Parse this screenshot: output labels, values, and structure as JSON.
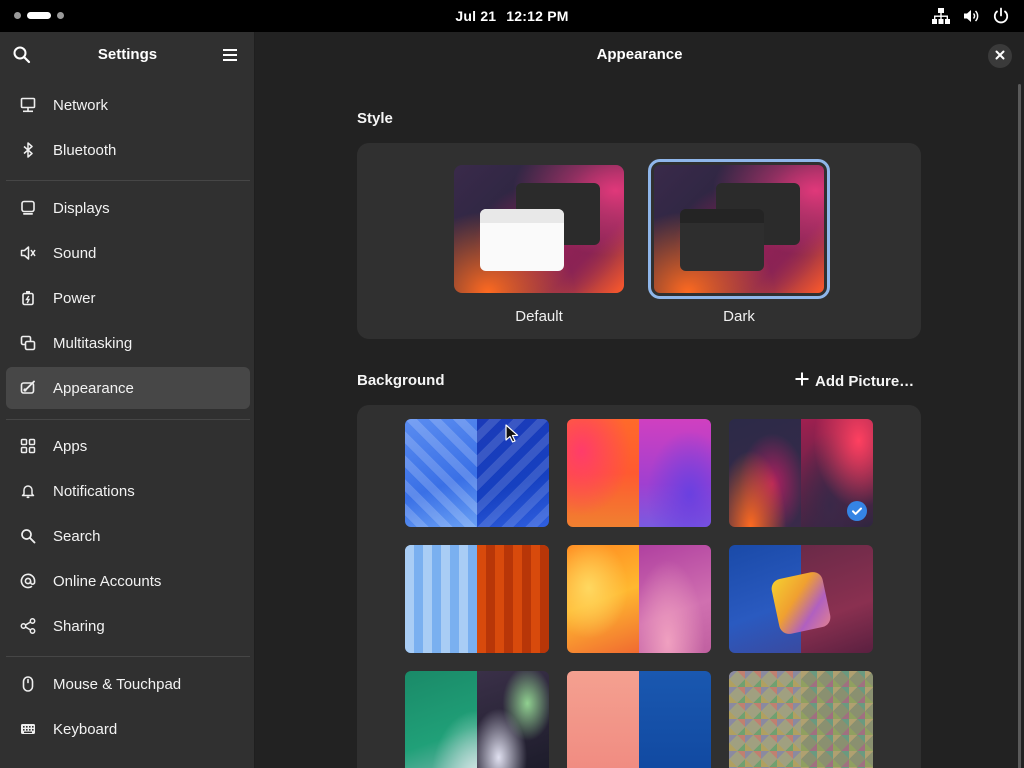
{
  "topbar": {
    "date": "Jul 21",
    "time": "12:12 PM",
    "icons": [
      "network-wired-icon",
      "volume-icon",
      "power-icon"
    ]
  },
  "sidebar": {
    "title": "Settings",
    "items": [
      {
        "label": "Network",
        "icon": "network-icon"
      },
      {
        "label": "Bluetooth",
        "icon": "bluetooth-icon"
      },
      {
        "label": "Displays",
        "icon": "display-icon"
      },
      {
        "label": "Sound",
        "icon": "speaker-icon"
      },
      {
        "label": "Power",
        "icon": "battery-icon"
      },
      {
        "label": "Multitasking",
        "icon": "multitasking-icon"
      },
      {
        "label": "Appearance",
        "icon": "appearance-icon",
        "active": true
      },
      {
        "label": "Apps",
        "icon": "apps-grid-icon"
      },
      {
        "label": "Notifications",
        "icon": "bell-icon"
      },
      {
        "label": "Search",
        "icon": "search-icon"
      },
      {
        "label": "Online Accounts",
        "icon": "at-sign-icon"
      },
      {
        "label": "Sharing",
        "icon": "share-icon"
      },
      {
        "label": "Mouse & Touchpad",
        "icon": "mouse-icon"
      },
      {
        "label": "Keyboard",
        "icon": "keyboard-icon"
      }
    ]
  },
  "main": {
    "title": "Appearance",
    "style_section": {
      "title": "Style",
      "options": [
        {
          "label": "Default",
          "selected": false
        },
        {
          "label": "Dark",
          "selected": true
        }
      ]
    },
    "background_section": {
      "title": "Background",
      "add_label": "Add Picture…",
      "selected_index": 2
    }
  },
  "colors": {
    "accent": "#3584e4",
    "sidebar_bg": "#303030",
    "main_bg": "#222222",
    "card_bg": "#303030",
    "selection_outline": "#8fb6ea"
  }
}
